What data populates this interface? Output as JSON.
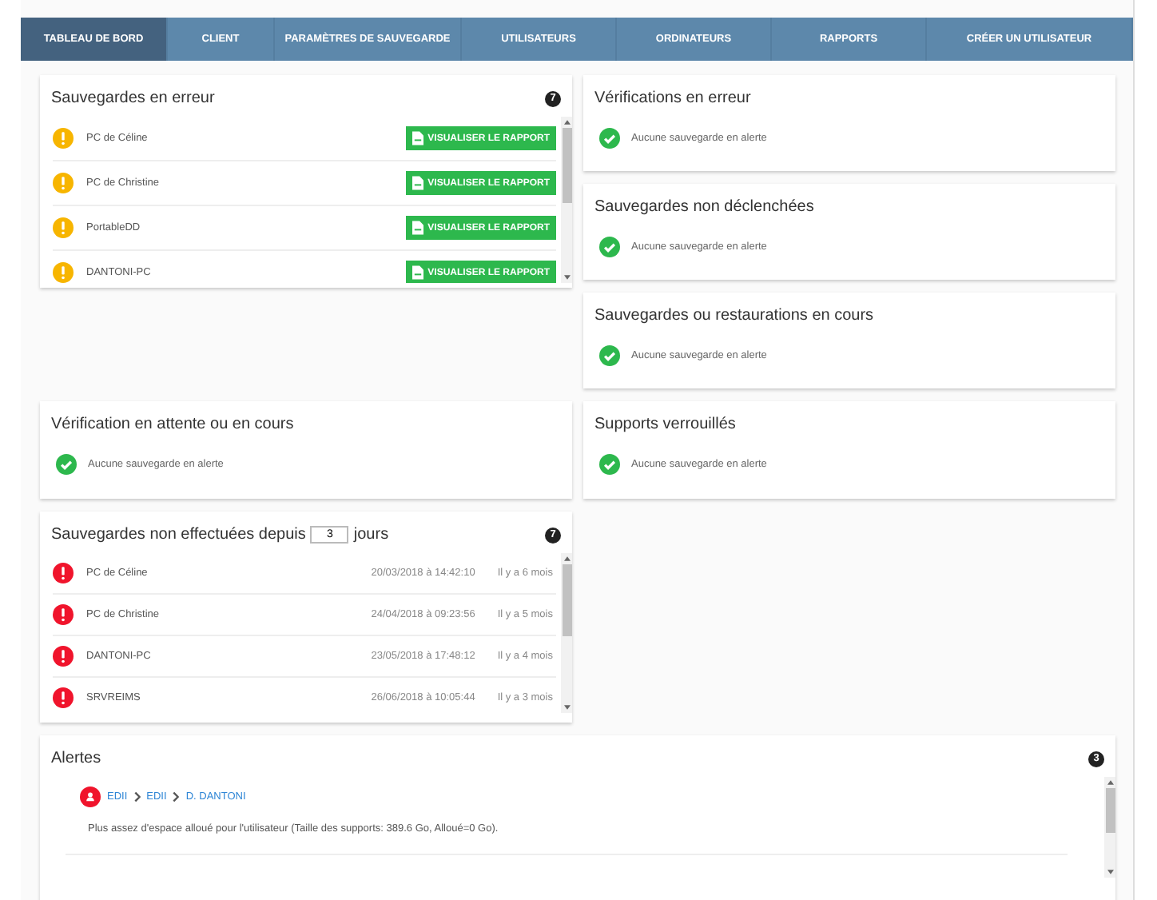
{
  "tabs": [
    {
      "label": "TABLEAU DE BORD",
      "selected": true
    },
    {
      "label": "CLIENT",
      "selected": false
    },
    {
      "label": "PARAMÈTRES DE SAUVEGARDE",
      "selected": false
    },
    {
      "label": "UTILISATEURS",
      "selected": false
    },
    {
      "label": "ORDINATEURS",
      "selected": false
    },
    {
      "label": "RAPPORTS",
      "selected": false
    },
    {
      "label": "CRÉER UN UTILISATEUR",
      "selected": false
    }
  ],
  "failed_backups": {
    "title": "Sauvegardes en erreur",
    "count": "7",
    "items": [
      {
        "name": "PC de Céline",
        "button": "VISUALISER LE RAPPORT"
      },
      {
        "name": "PC de Christine",
        "button": "VISUALISER LE RAPPORT"
      },
      {
        "name": "PortableDD",
        "button": "VISUALISER LE RAPPORT"
      },
      {
        "name": "DANTONI-PC",
        "button": "VISUALISER LE RAPPORT"
      }
    ]
  },
  "ok_panels": [
    {
      "title": "Vérifications en erreur",
      "message": "Aucune sauvegarde en alerte"
    },
    {
      "title": "Sauvegardes non déclenchées",
      "message": "Aucune sauvegarde en alerte"
    },
    {
      "title": "Sauvegardes ou restaurations en cours",
      "message": "Aucune sauvegarde en alerte"
    },
    {
      "title": "Vérification en attente ou en cours",
      "message": "Aucune sauvegarde en alerte"
    },
    {
      "title": "Supports verrouillés",
      "message": "Aucune sauvegarde en alerte"
    }
  ],
  "missed_backups": {
    "title_before": "Sauvegardes non effectuées depuis",
    "days": "3",
    "title_after": "jours",
    "count": "7",
    "items": [
      {
        "name": "PC de Céline",
        "date": "20/03/2018 à 14:42:10",
        "ago": "Il y a 6 mois"
      },
      {
        "name": "PC de Christine",
        "date": "24/04/2018 à 09:23:56",
        "ago": "Il y a 5 mois"
      },
      {
        "name": "DANTONI-PC",
        "date": "23/05/2018 à 17:48:12",
        "ago": "Il y a 4 mois"
      },
      {
        "name": "SRVREIMS",
        "date": "26/06/2018 à 10:05:44",
        "ago": "Il y a 3 mois"
      }
    ]
  },
  "alerts": {
    "title": "Alertes",
    "count": "3",
    "items": [
      {
        "path": [
          "EDII",
          "EDII",
          "D. DANTONI"
        ],
        "message": "Plus assez d'espace alloué pour l'utilisateur (Taille des supports: 389.6 Go, Alloué=0 Go)."
      }
    ]
  }
}
